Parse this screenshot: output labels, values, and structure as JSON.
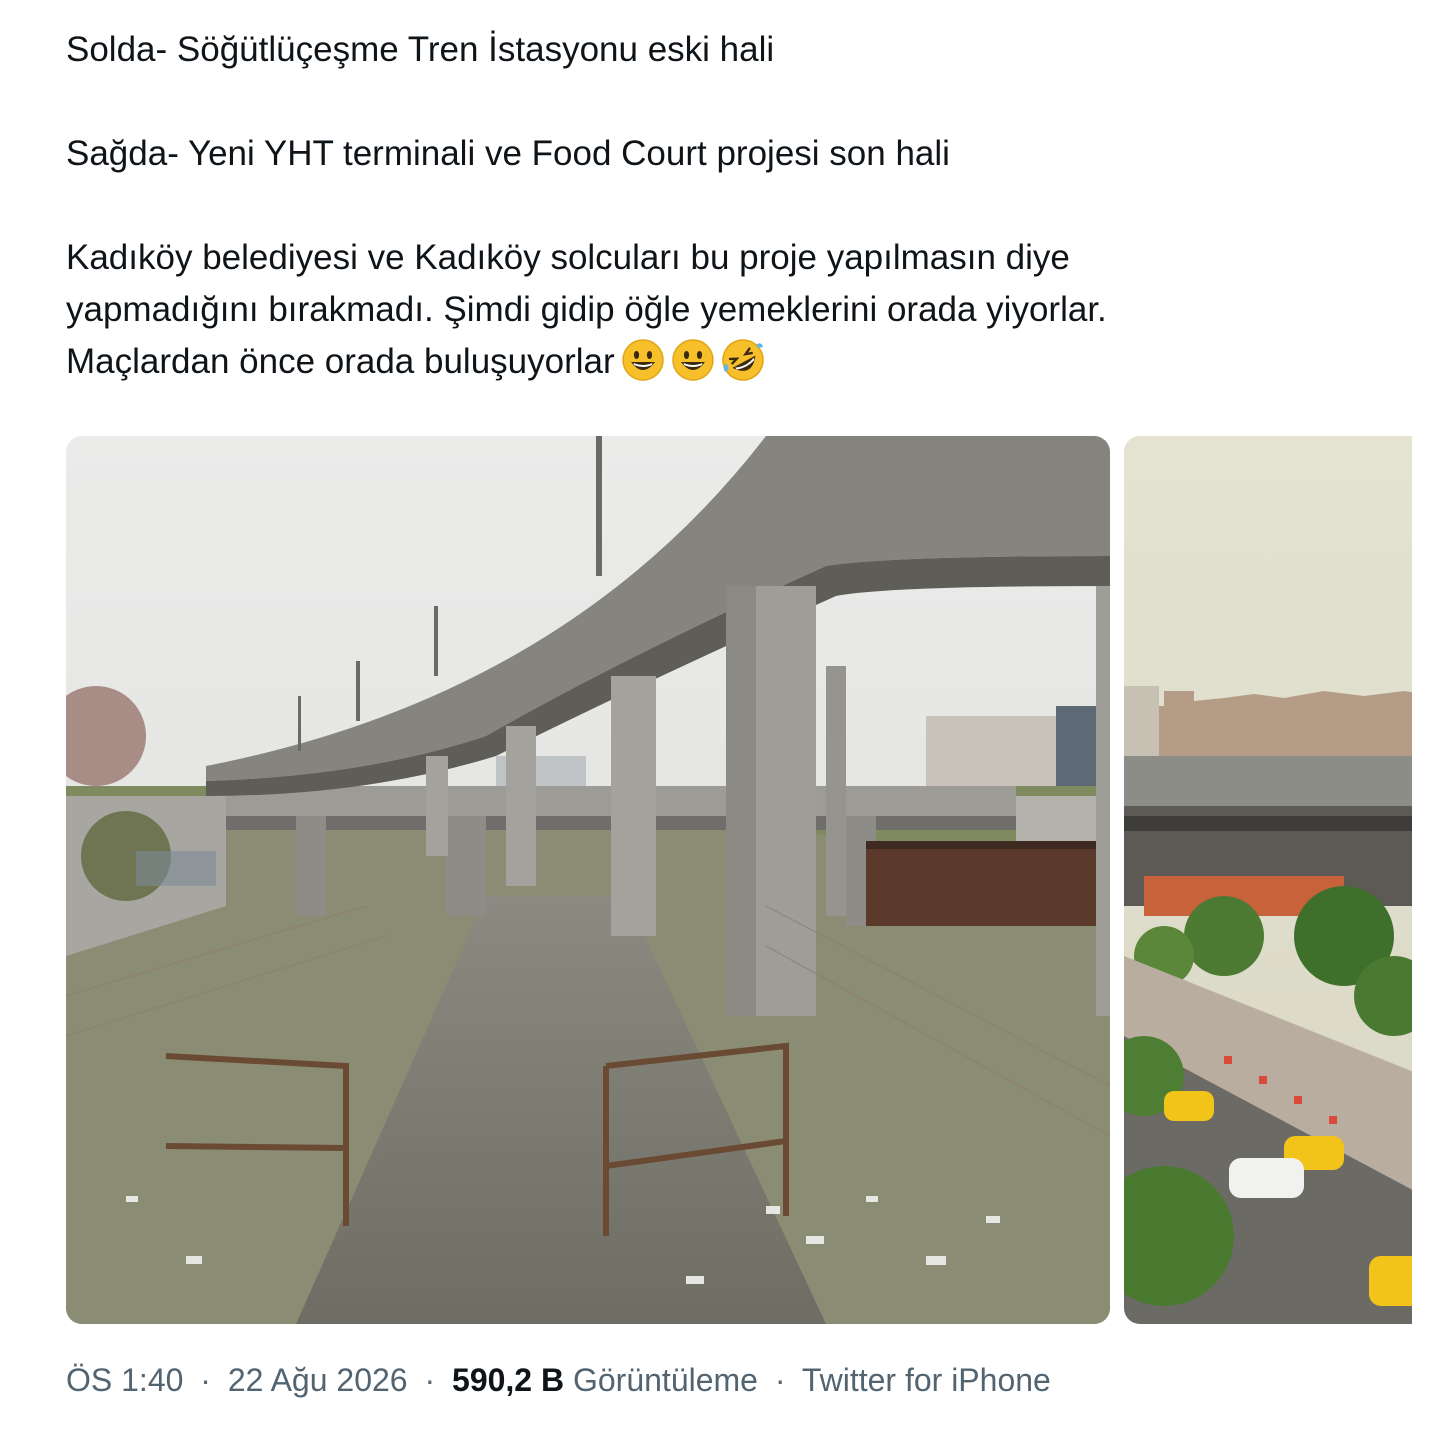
{
  "tweet": {
    "line1": "Solda- Söğütlüçeşme Tren İstasyonu eski hali",
    "line2": "Sağda- Yeni YHT terminali ve Food Court projesi son hali",
    "line3": "Kadıköy belediyesi ve Kadıköy solcuları bu proje yapılmasın diye",
    "line4": "yapmadığını bırakmadı. Şimdi gidip öğle yemeklerini orada yiyorlar.",
    "line5": "Maçlardan önce orada buluşuyorlar",
    "emojis": [
      "grinning-face-emoji",
      "grinning-face-emoji",
      "rolling-on-floor-laughing-emoji"
    ]
  },
  "media": {
    "left_photo": "old-station-viaduct-photo",
    "right_photo": "new-terminal-food-court-photo"
  },
  "meta": {
    "time": "ÖS 1:40",
    "date": "22 Ağu 2026",
    "views_count": "590,2 B",
    "views_label": "Görüntüleme",
    "source": "Twitter for iPhone",
    "separator": "·"
  },
  "colors": {
    "text": "#0f1419",
    "muted": "#536471",
    "emoji_yellow": "#f7c02a"
  }
}
